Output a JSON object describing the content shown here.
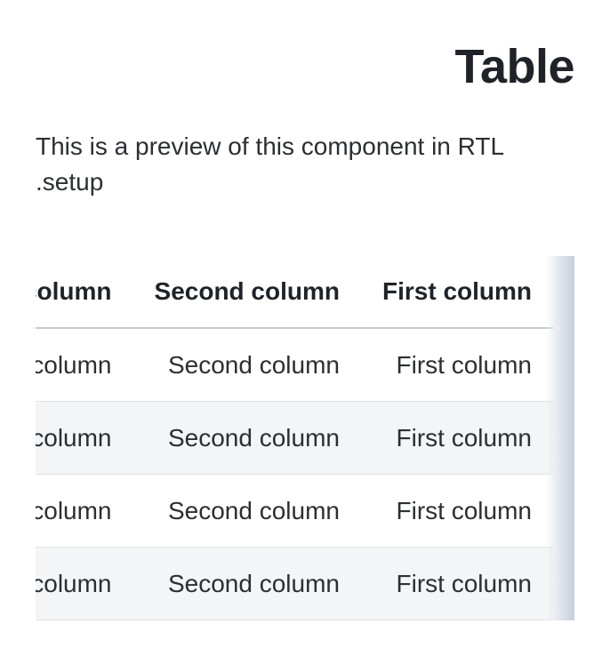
{
  "page": {
    "title": "Table",
    "description": "This is a preview of this component in RTL .setup"
  },
  "table": {
    "headers": [
      "First column",
      "Second column",
      "Third column"
    ],
    "rows": [
      [
        "First column",
        "Second column",
        "Third column"
      ],
      [
        "First column",
        "Second column",
        "Third column"
      ],
      [
        "First column",
        "Second column",
        "Third column"
      ],
      [
        "First column",
        "Second column",
        "Third column"
      ]
    ]
  }
}
